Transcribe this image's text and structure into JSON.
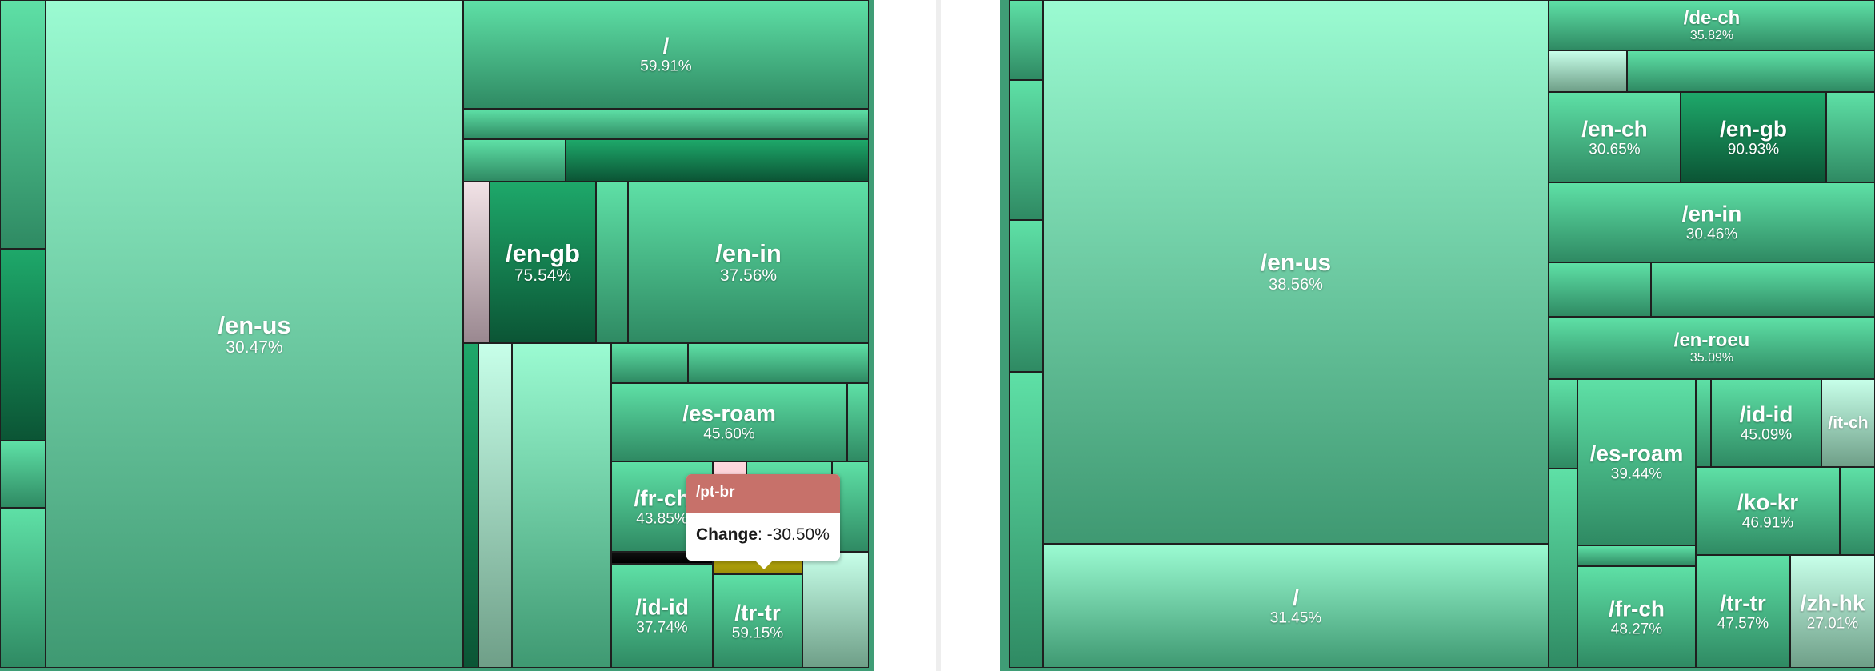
{
  "colors": {
    "gain_light": "#8af5c4",
    "gain_mid": "#4cc48e",
    "gain_dark": "#0f6a42",
    "loss": "#c7716a",
    "warn": "#b5a20c"
  },
  "tooltip": {
    "title": "/pt-br",
    "label": "Change",
    "value": ": -30.50%"
  },
  "chart_data": [
    {
      "type": "heatmap",
      "subtype": "treemap",
      "cells": [
        {
          "name": "/en-us",
          "value": 30.47,
          "label": "30.47%"
        },
        {
          "name": "/",
          "value": 59.91,
          "label": "59.91%"
        },
        {
          "name": "/en-gb",
          "value": 75.54,
          "label": "75.54%"
        },
        {
          "name": "/en-in",
          "value": 37.56,
          "label": "37.56%"
        },
        {
          "name": "/es-roam",
          "value": 45.6,
          "label": "45.60%"
        },
        {
          "name": "/fr-ch",
          "value": 43.85,
          "label": "43.85%"
        },
        {
          "name": "/id-id",
          "value": 37.74,
          "label": "37.74%"
        },
        {
          "name": "/tr-tr",
          "value": 59.15,
          "label": "59.15%"
        },
        {
          "name": "/pt-br",
          "value": -30.5,
          "label": "-30.50%"
        }
      ]
    },
    {
      "type": "heatmap",
      "subtype": "treemap",
      "cells": [
        {
          "name": "/en-us",
          "value": 38.56,
          "label": "38.56%"
        },
        {
          "name": "/",
          "value": 31.45,
          "label": "31.45%"
        },
        {
          "name": "/de-ch",
          "value": 35.82,
          "label": "35.82%"
        },
        {
          "name": "/en-ch",
          "value": 30.65,
          "label": "30.65%"
        },
        {
          "name": "/en-gb",
          "value": 90.93,
          "label": "90.93%"
        },
        {
          "name": "/en-in",
          "value": 30.46,
          "label": "30.46%"
        },
        {
          "name": "/en-roeu",
          "value": 35.09,
          "label": "35.09%"
        },
        {
          "name": "/es-roam",
          "value": 39.44,
          "label": "39.44%"
        },
        {
          "name": "/id-id",
          "value": 45.09,
          "label": "45.09%"
        },
        {
          "name": "/it-ch",
          "value": null,
          "label": ""
        },
        {
          "name": "/ko-kr",
          "value": 46.91,
          "label": "46.91%"
        },
        {
          "name": "/fr-ch",
          "value": 48.27,
          "label": "48.27%"
        },
        {
          "name": "/tr-tr",
          "value": 47.57,
          "label": "47.57%"
        },
        {
          "name": "/zh-hk",
          "value": 27.01,
          "label": "27.01%"
        }
      ]
    }
  ]
}
